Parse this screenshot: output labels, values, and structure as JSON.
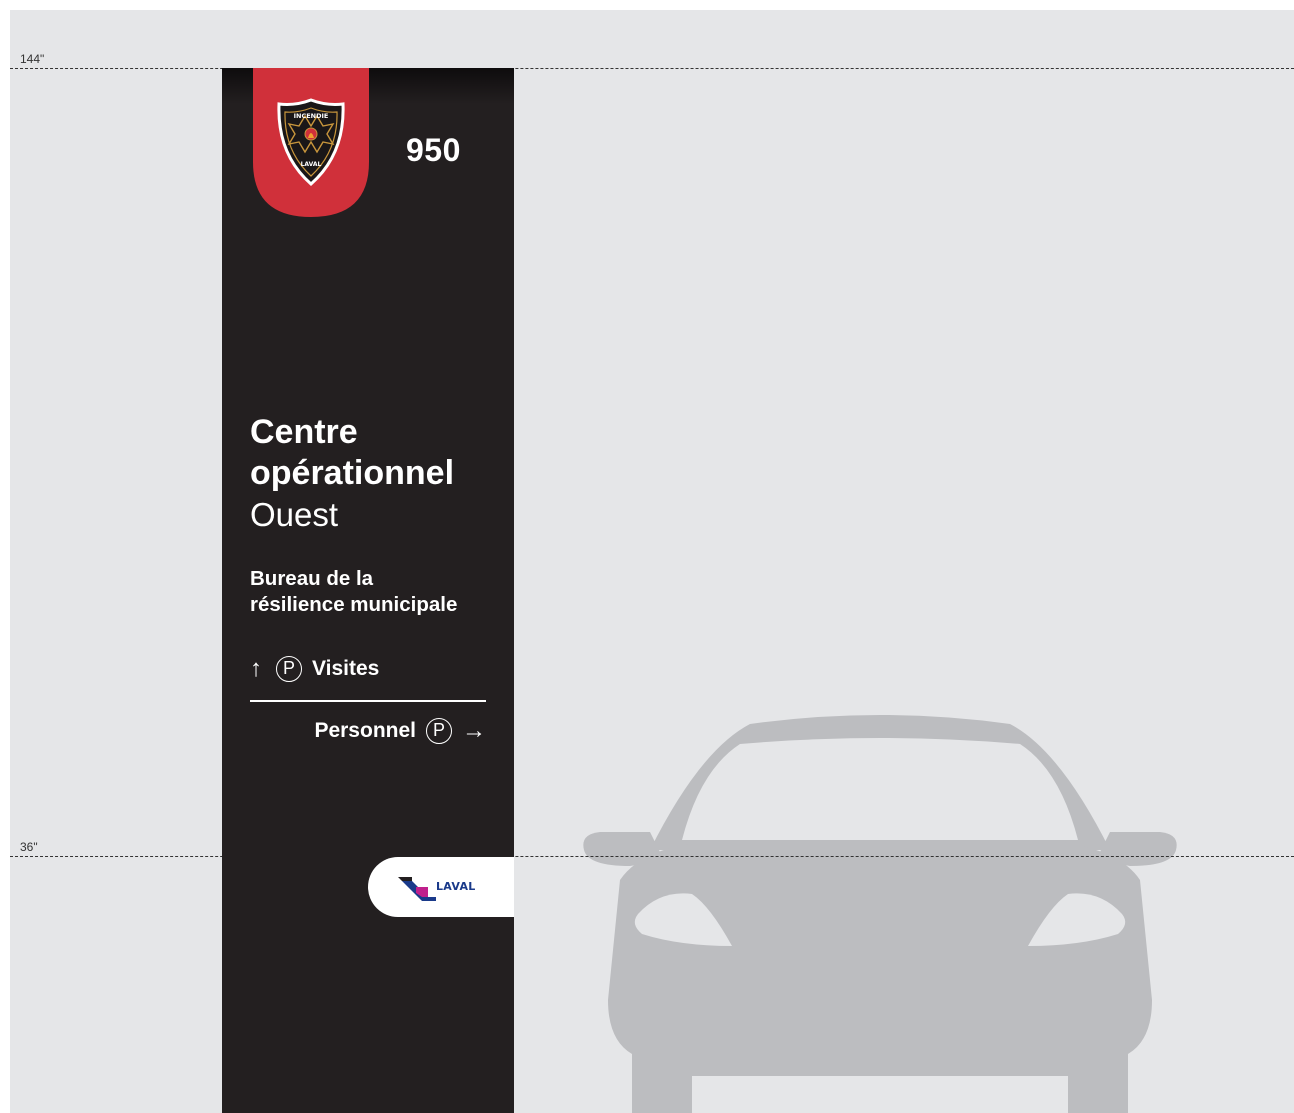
{
  "dimensions": {
    "upper": "144\"",
    "lower": "36\""
  },
  "sign": {
    "address_number": "950",
    "badge_text_top": "INCENDIE",
    "badge_text_bottom": "LAVAL",
    "title_line1": "Centre",
    "title_line2": "opérationnel",
    "title_sub": "Ouest",
    "bureau_line1": "Bureau de la",
    "bureau_line2": "résilience municipale",
    "parking_symbol": "P",
    "directions": [
      {
        "arrow": "↑",
        "label": "Visites"
      },
      {
        "arrow": "→",
        "label": "Personnel"
      }
    ],
    "city_logo_text": "LAVAL"
  },
  "colors": {
    "sign_background": "#231f20",
    "badge_red": "#d0303a",
    "canvas_background": "#e5e6e8",
    "car_silhouette": "#bcbdc0",
    "logo_blue": "#1a3a8a",
    "logo_magenta": "#c0208c"
  },
  "icons": {
    "fire_badge": "fire-department-shield-icon",
    "up_arrow": "arrow-up-icon",
    "right_arrow": "arrow-right-icon",
    "parking": "parking-circle-icon",
    "city_logo": "laval-logo-icon",
    "car": "car-front-silhouette-icon"
  }
}
